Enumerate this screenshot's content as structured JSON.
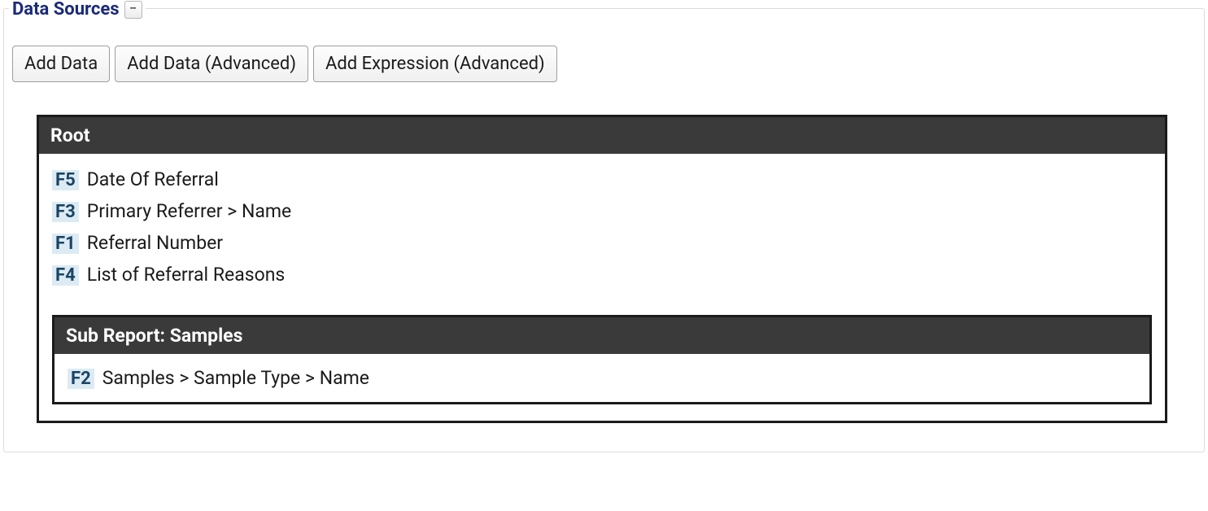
{
  "section": {
    "title": "Data Sources"
  },
  "toolbar": {
    "add_data": "Add Data",
    "add_data_advanced": "Add Data (Advanced)",
    "add_expression_advanced": "Add Expression (Advanced)"
  },
  "root_panel": {
    "title": "Root",
    "fields": [
      {
        "tag": "F5",
        "label": "Date Of Referral"
      },
      {
        "tag": "F3",
        "label": "Primary Referrer > Name"
      },
      {
        "tag": "F1",
        "label": "Referral Number"
      },
      {
        "tag": "F4",
        "label": "List of Referral Reasons"
      }
    ]
  },
  "sub_panel": {
    "title": "Sub Report: Samples",
    "fields": [
      {
        "tag": "F2",
        "label": "Samples > Sample Type > Name"
      }
    ]
  }
}
